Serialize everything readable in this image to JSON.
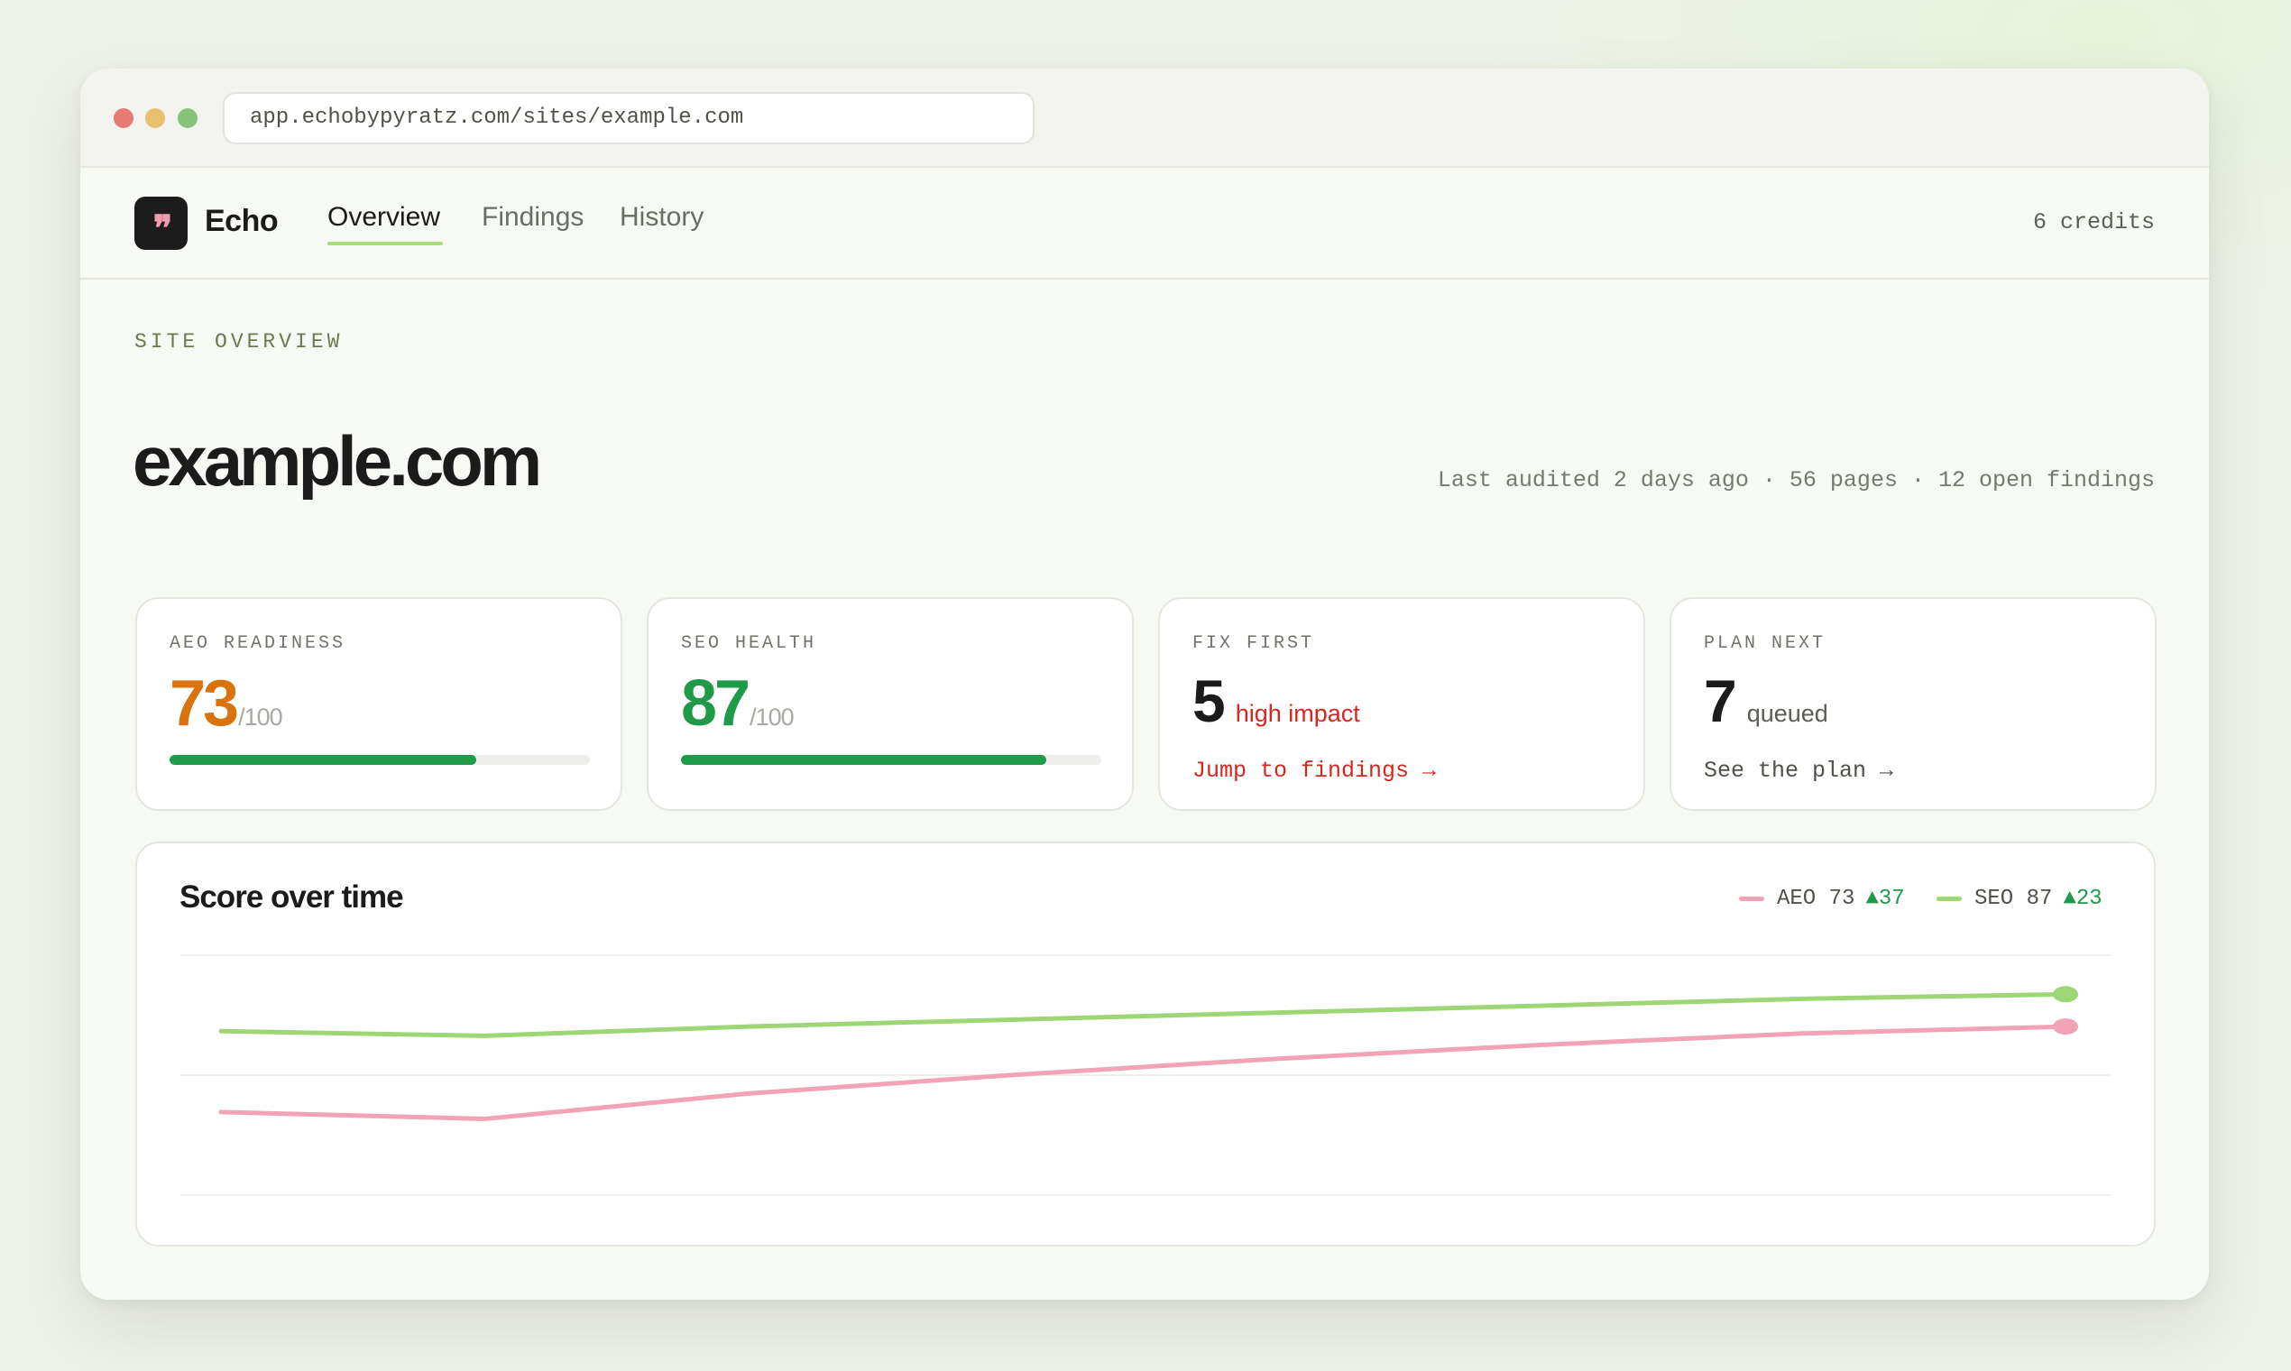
{
  "browser": {
    "url": "app.echobypyratz.com/sites/example.com"
  },
  "app": {
    "logo_glyph": "❞",
    "name": "Echo",
    "tabs": [
      {
        "label": "Overview",
        "active": true
      },
      {
        "label": "Findings",
        "active": false
      },
      {
        "label": "History",
        "active": false
      }
    ],
    "credits": "6 credits",
    "accent_color": "#a9dc76"
  },
  "overview": {
    "section_label": "SITE OVERVIEW",
    "site": "example.com",
    "meta": "Last audited 2 days ago · 56 pages · 12 open findings"
  },
  "cards": {
    "aeo": {
      "label": "AEO READINESS",
      "value": "73",
      "suffix": "/100",
      "progress": 0.73,
      "color": "#d9730d"
    },
    "seo": {
      "label": "SEO HEALTH",
      "value": "87",
      "suffix": "/100",
      "progress": 0.87,
      "color": "#1f9a48"
    },
    "fix": {
      "label": "FIX FIRST",
      "value": "5",
      "note": "high impact",
      "link": "Jump to findings →",
      "color": "#d7261e"
    },
    "plan": {
      "label": "PLAN NEXT",
      "value": "7",
      "note": "queued",
      "link": "See the plan →"
    }
  },
  "chart": {
    "title": "Score over time",
    "legend": [
      {
        "series": "AEO",
        "value": "73",
        "delta": "▲37",
        "color": "#f2a3b8"
      },
      {
        "series": "SEO",
        "value": "87",
        "delta": "▲23",
        "color": "#9dd775"
      }
    ]
  },
  "chart_data": {
    "type": "line",
    "title": "Score over time",
    "x": [
      0,
      1,
      2,
      3,
      4,
      5,
      6,
      7
    ],
    "ylim": [
      0,
      100
    ],
    "grid": true,
    "legend_position": "top-right",
    "series": [
      {
        "name": "AEO",
        "color": "#f2a3b8",
        "values": [
          36,
          33,
          44,
          52,
          59,
          65,
          70,
          73
        ]
      },
      {
        "name": "SEO",
        "color": "#9dd775",
        "values": [
          71,
          69,
          73,
          76,
          79,
          82,
          85,
          87
        ]
      }
    ]
  }
}
